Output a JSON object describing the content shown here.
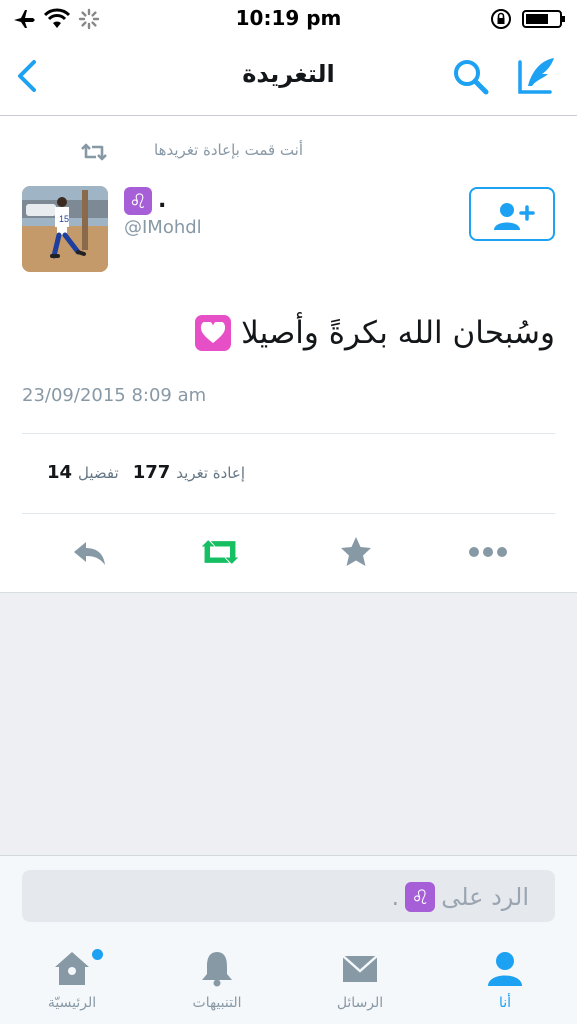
{
  "status_bar": {
    "time": "10:19 pm",
    "icons": [
      "airplane-icon",
      "wifi-icon",
      "activity-spinner-icon",
      "rotation-lock-icon",
      "battery-icon"
    ]
  },
  "nav": {
    "title": "التغريدة",
    "back_icon": "chevron-left-icon",
    "search_icon": "search-icon",
    "compose_icon": "compose-feather-icon"
  },
  "tweet": {
    "retweet_context": "أنت قمت بإعادة تغريدها",
    "author_name": ".",
    "author_badge": "♌",
    "handle": "@IMohdl",
    "text": "وسُبحان الله بكرةً وأصيلا",
    "emoji": "heart-emoji",
    "timestamp": "23/09/2015 8:09 am",
    "stats": {
      "retweets_count": "177",
      "retweets_label": "إعادة تغريد",
      "likes_count": "14",
      "likes_label": "تفضيل"
    },
    "retweeted": true
  },
  "reply": {
    "placeholder_prefix": "الرد على",
    "placeholder_suffix": "."
  },
  "tabs": [
    {
      "label": "الرئيسيّة",
      "icon": "home-icon",
      "has_dot": true
    },
    {
      "label": "التنبيهات",
      "icon": "bell-icon"
    },
    {
      "label": "الرسائل",
      "icon": "envelope-icon"
    },
    {
      "label": "أنا",
      "icon": "person-icon",
      "active": true
    }
  ],
  "colors": {
    "accent": "#1da1f2",
    "retweet_green": "#17bf63",
    "muted": "#8899a6",
    "badge_purple": "#a75fd8",
    "heart_pink": "#e74fc7"
  }
}
